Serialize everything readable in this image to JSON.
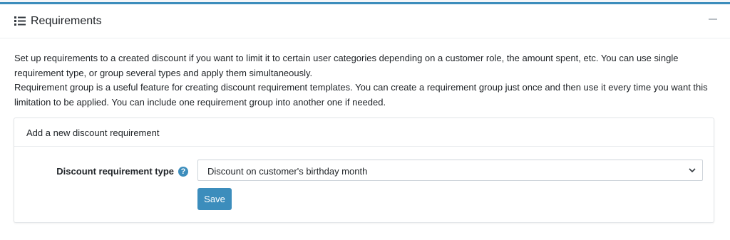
{
  "card": {
    "title": "Requirements",
    "icon": "list-icon",
    "description": [
      "Set up requirements to a created discount if you want to limit it to certain user categories depending on a customer role, the amount spent, etc. You can use single requirement type, or group several types and apply them simultaneously.",
      "Requirement group is a useful feature for creating discount requirement templates. You can create a requirement group just once and then use it every time you want this limitation to be applied. You can include one requirement group into another one if needed."
    ]
  },
  "add_requirement": {
    "title": "Add a new discount requirement",
    "field_label": "Discount requirement type",
    "help_icon": "?",
    "selected_type": "Discount on customer's birthday month",
    "save_label": "Save"
  },
  "colors": {
    "accent": "#3c8dbc",
    "background": "#f4f6f9"
  }
}
